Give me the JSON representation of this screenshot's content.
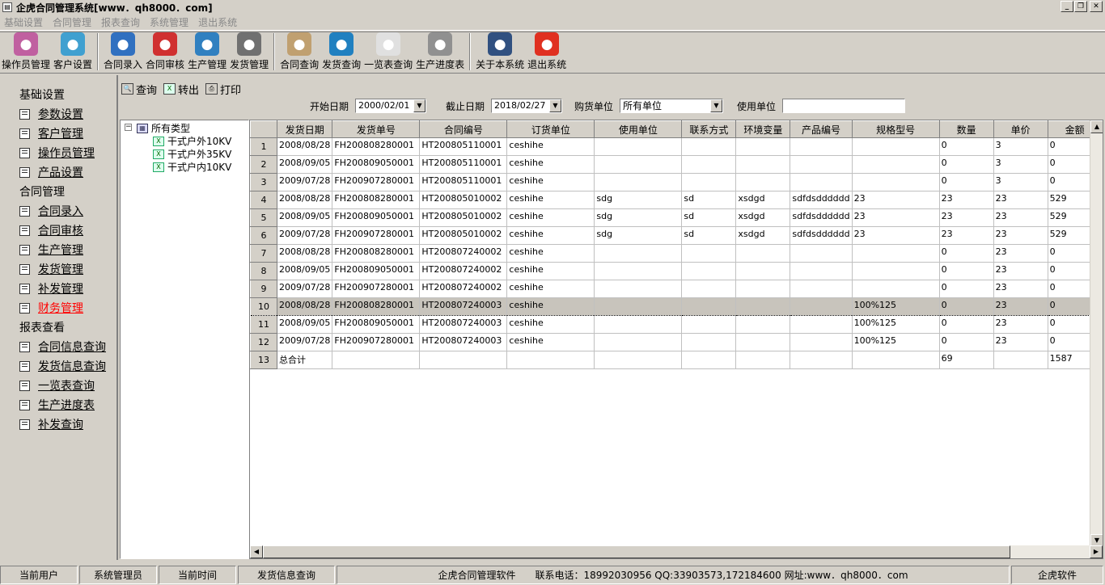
{
  "window": {
    "title": "企虎合同管理系统[www．qh8000．com]"
  },
  "menu": [
    "基础设置",
    "合同管理",
    "报表查询",
    "系统管理",
    "退出系统"
  ],
  "toolbar": [
    {
      "label": "操作员管理",
      "icon": "operator-icon",
      "color": "#c060a0"
    },
    {
      "label": "客户设置",
      "icon": "customer-icon",
      "color": "#40a0d0"
    },
    {
      "sep": true
    },
    {
      "label": "合同录入",
      "icon": "contract-entry-icon",
      "color": "#3070c0"
    },
    {
      "label": "合同审核",
      "icon": "contract-audit-icon",
      "color": "#d03030"
    },
    {
      "label": "生产管理",
      "icon": "production-icon",
      "color": "#3080c0"
    },
    {
      "label": "发货管理",
      "icon": "shipping-icon",
      "color": "#707070"
    },
    {
      "sep": true
    },
    {
      "label": "合同查询",
      "icon": "contract-search-icon",
      "color": "#c0a070"
    },
    {
      "label": "发货查询",
      "icon": "shipping-search-icon",
      "color": "#2080c0"
    },
    {
      "label": "一览表查询",
      "icon": "overview-icon",
      "color": "#e0e0e0"
    },
    {
      "label": "生产进度表",
      "icon": "progress-icon",
      "color": "#909090"
    },
    {
      "sep": true
    },
    {
      "label": "关于本系统",
      "icon": "about-icon",
      "color": "#305080"
    },
    {
      "label": "退出系统",
      "icon": "exit-icon",
      "color": "#e03020"
    }
  ],
  "sidebar": {
    "sections": [
      {
        "title": "基础设置",
        "items": [
          "参数设置",
          "客户管理",
          "操作员管理",
          "产品设置"
        ]
      },
      {
        "title": "合同管理",
        "items": [
          "合同录入",
          "合同审核",
          "生产管理",
          "发货管理",
          "补发管理",
          "财务管理"
        ]
      },
      {
        "title": "报表查看",
        "items": [
          "合同信息查询",
          "发货信息查询",
          "一览表查询",
          "生产进度表",
          "补发查询"
        ]
      }
    ],
    "active": "财务管理"
  },
  "actions": {
    "query": "查询",
    "export": "转出",
    "print": "打印"
  },
  "filters": {
    "start_label": "开始日期",
    "start_value": "2000/02/01",
    "end_label": "截止日期",
    "end_value": "2018/02/27",
    "buyer_label": "购货单位",
    "buyer_value": "所有单位",
    "user_label": "使用单位",
    "user_value": ""
  },
  "tree": {
    "root": "所有类型",
    "children": [
      "干式户外10KV",
      "干式户外35KV",
      "干式户内10KV"
    ]
  },
  "grid": {
    "columns": [
      "发货日期",
      "发货单号",
      "合同编号",
      "订货单位",
      "使用单位",
      "联系方式",
      "环境变量",
      "产品编号",
      "规格型号",
      "数量",
      "单价",
      "金额"
    ],
    "selected_row": 10,
    "rows": [
      [
        "2008/08/28",
        "FH200808280001",
        "HT200805110001",
        "ceshihe",
        "",
        "",
        "",
        "",
        "",
        "0",
        "3",
        "0"
      ],
      [
        "2008/09/05",
        "FH200809050001",
        "HT200805110001",
        "ceshihe",
        "",
        "",
        "",
        "",
        "",
        "0",
        "3",
        "0"
      ],
      [
        "2009/07/28",
        "FH200907280001",
        "HT200805110001",
        "ceshihe",
        "",
        "",
        "",
        "",
        "",
        "0",
        "3",
        "0"
      ],
      [
        "2008/08/28",
        "FH200808280001",
        "HT200805010002",
        "ceshihe",
        "sdg",
        "sd",
        "xsdgd",
        "sdfdsdddddd",
        "23",
        "23",
        "23",
        "529"
      ],
      [
        "2008/09/05",
        "FH200809050001",
        "HT200805010002",
        "ceshihe",
        "sdg",
        "sd",
        "xsdgd",
        "sdfdsdddddd",
        "23",
        "23",
        "23",
        "529"
      ],
      [
        "2009/07/28",
        "FH200907280001",
        "HT200805010002",
        "ceshihe",
        "sdg",
        "sd",
        "xsdgd",
        "sdfdsdddddd",
        "23",
        "23",
        "23",
        "529"
      ],
      [
        "2008/08/28",
        "FH200808280001",
        "HT200807240002",
        "ceshihe",
        "",
        "",
        "",
        "",
        "",
        "0",
        "23",
        "0"
      ],
      [
        "2008/09/05",
        "FH200809050001",
        "HT200807240002",
        "ceshihe",
        "",
        "",
        "",
        "",
        "",
        "0",
        "23",
        "0"
      ],
      [
        "2009/07/28",
        "FH200907280001",
        "HT200807240002",
        "ceshihe",
        "",
        "",
        "",
        "",
        "",
        "0",
        "23",
        "0"
      ],
      [
        "2008/08/28",
        "FH200808280001",
        "HT200807240003",
        "ceshihe",
        "",
        "",
        "",
        "",
        "100%125",
        "0",
        "23",
        "0"
      ],
      [
        "2008/09/05",
        "FH200809050001",
        "HT200807240003",
        "ceshihe",
        "",
        "",
        "",
        "",
        "100%125",
        "0",
        "23",
        "0"
      ],
      [
        "2009/07/28",
        "FH200907280001",
        "HT200807240003",
        "ceshihe",
        "",
        "",
        "",
        "",
        "100%125",
        "0",
        "23",
        "0"
      ],
      [
        "总合计",
        "",
        "",
        "",
        "",
        "",
        "",
        "",
        "",
        "69",
        "",
        "1587"
      ]
    ]
  },
  "status": [
    "当前用户",
    "系统管理员",
    "当前时间",
    "发货信息查询",
    "企虎合同管理软件　　联系电话：18992030956 QQ:33903573,172184600 网址:www．qh8000．com",
    "企虎软件"
  ]
}
